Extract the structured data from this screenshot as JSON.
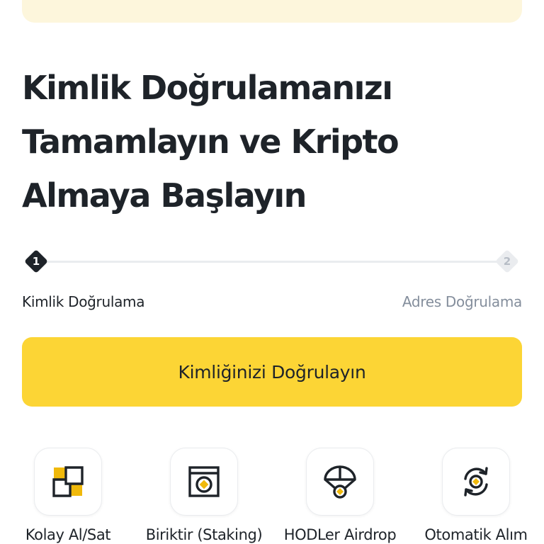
{
  "headline": {
    "lines": [
      "Kimlik Doğrulamanızı",
      "Tamamlayın ve Kripto",
      "Almaya Başlayın"
    ]
  },
  "progress": {
    "steps": [
      {
        "number": "1",
        "label": "Kimlik Doğrulama",
        "state": "active"
      },
      {
        "number": "2",
        "label": "Adres Doğrulama",
        "state": "inactive"
      }
    ]
  },
  "cta": {
    "label": "Kimliğinizi Doğrulayın"
  },
  "features": [
    {
      "label": "Kolay Al/Sat",
      "icon": "convert-blocks-icon"
    },
    {
      "label": "Biriktir (Staking)",
      "icon": "safe-icon"
    },
    {
      "label": "HODLer Airdrop",
      "icon": "parachute-icon"
    },
    {
      "label": "Otomatik Alım",
      "icon": "auto-invest-icon"
    }
  ],
  "colors": {
    "accent": "#FCD535",
    "text_primary": "#1E2329",
    "text_secondary": "#848E9C",
    "track": "#EAECEF",
    "banner": "#FDF6DC"
  }
}
